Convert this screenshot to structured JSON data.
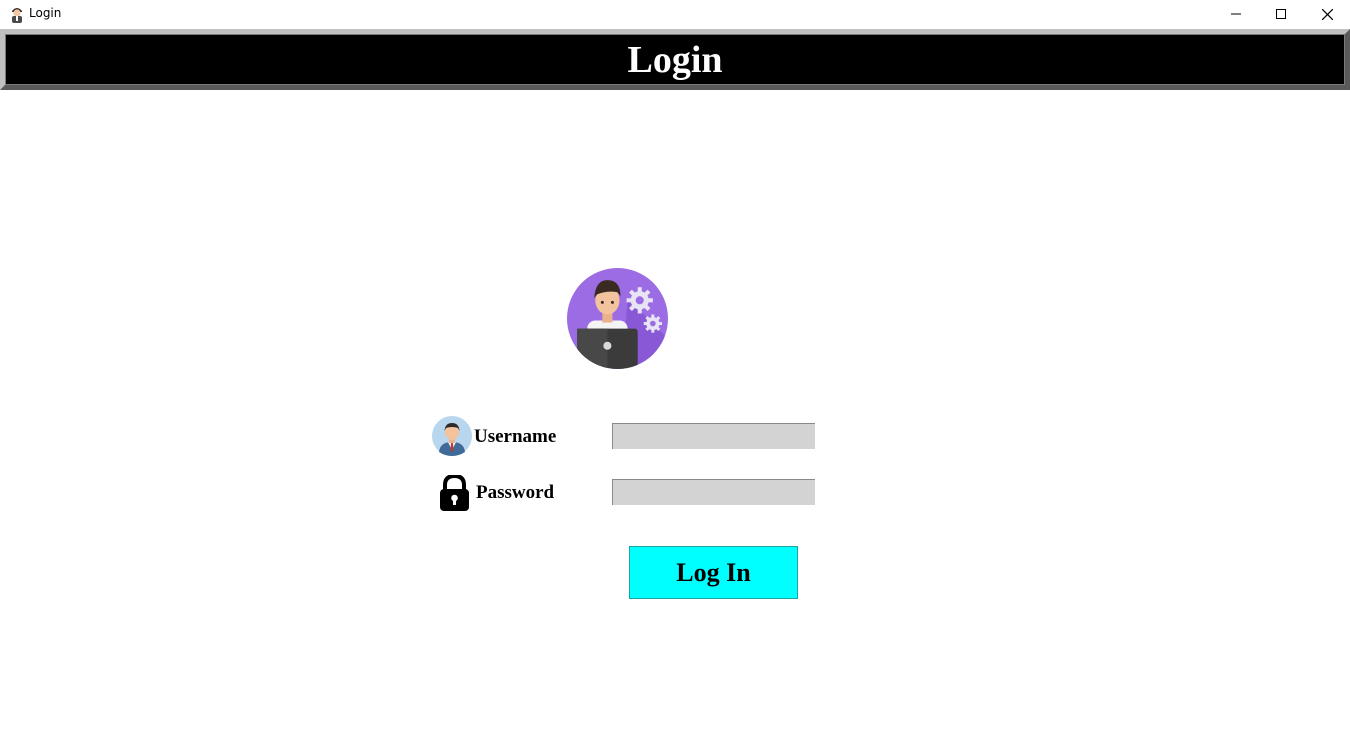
{
  "window": {
    "title": "Login",
    "controls": {
      "minimize": "minimize-icon",
      "maximize": "maximize-icon",
      "close": "close-icon"
    }
  },
  "header": {
    "title": "Login"
  },
  "form": {
    "username": {
      "label": "Username",
      "value": "",
      "placeholder": ""
    },
    "password": {
      "label": "Password",
      "value": "",
      "placeholder": ""
    },
    "submit_label": "Log In"
  },
  "colors": {
    "header_bg": "#000000",
    "entry_bg": "#d3d3d3",
    "button_bg": "#00ffff",
    "avatar_bg": "#8a5cd8"
  }
}
